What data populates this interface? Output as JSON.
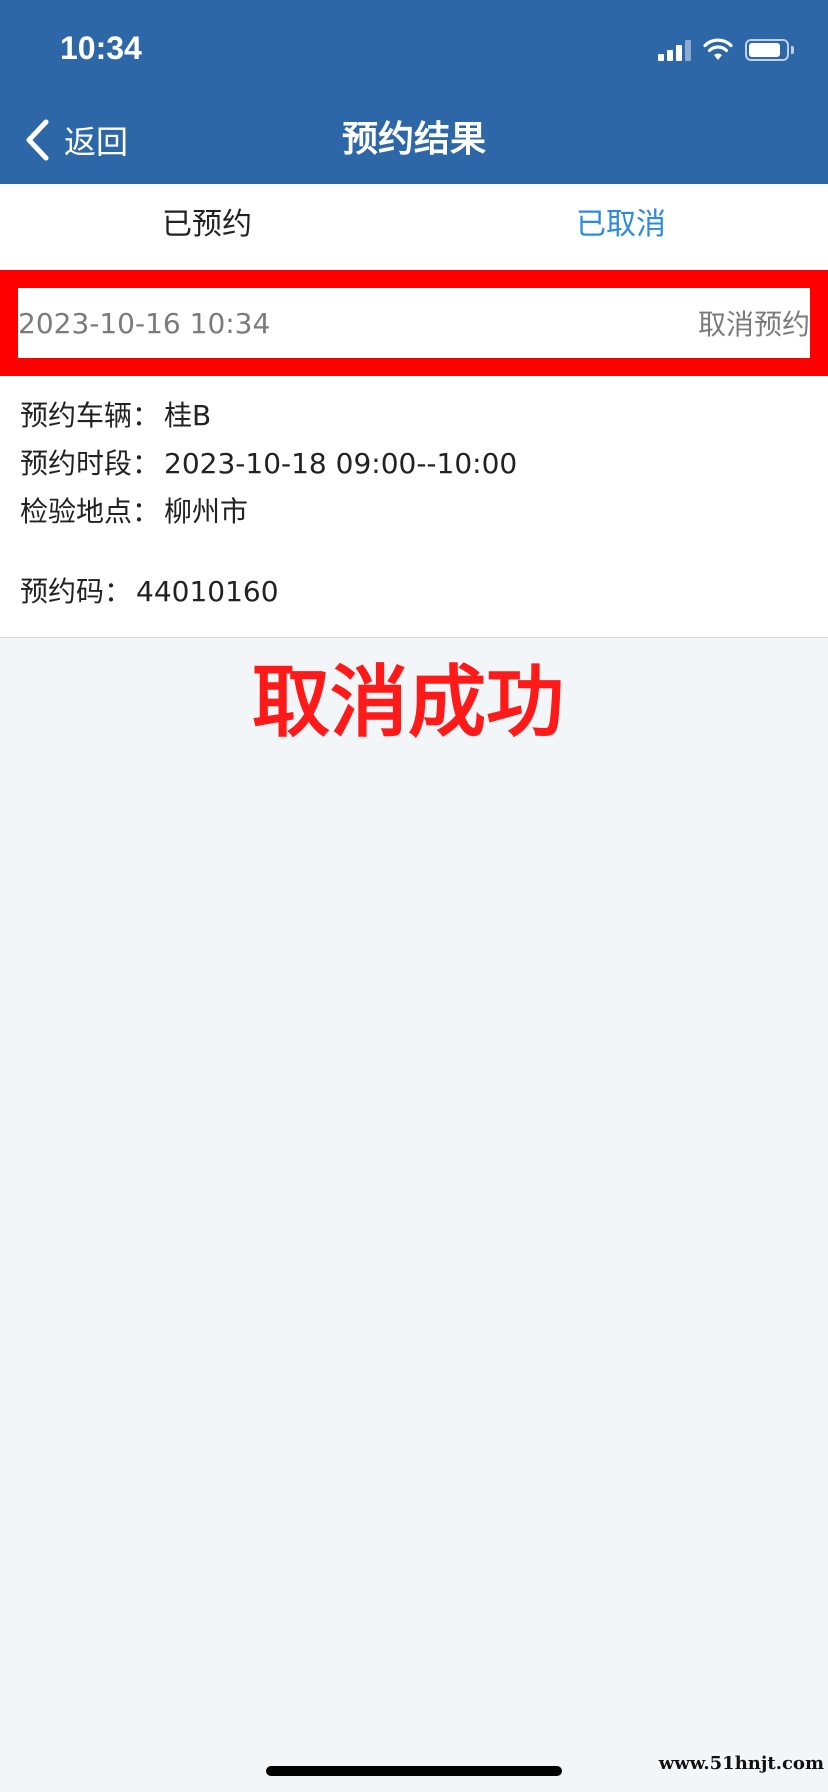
{
  "status_bar": {
    "time": "10:34",
    "battery_level": 0.85
  },
  "nav": {
    "back_label": "返回",
    "title": "预约结果"
  },
  "tabs": [
    {
      "label": "已预约",
      "active": false
    },
    {
      "label": "已取消",
      "active": true
    }
  ],
  "appointment": {
    "created_at": "2023-10-16 10:34",
    "cancel_label": "取消预约",
    "vehicle_label": "预约车辆：",
    "vehicle_value": "桂B",
    "timeslot_label": "预约时段：",
    "timeslot_value": "2023-10-18 09:00--10:00",
    "location_label": "检验地点：",
    "location_value": "柳州市",
    "code_label": "预约码：",
    "code_value": "44010160"
  },
  "overlay": {
    "result_text": "取消成功",
    "watermark": "www.51hnjt.com"
  },
  "colors": {
    "header_bg": "#2d67a8",
    "tab_active": "#2e8ae0",
    "highlight": "#ff0000",
    "page_bg": "#f3f6f8"
  }
}
